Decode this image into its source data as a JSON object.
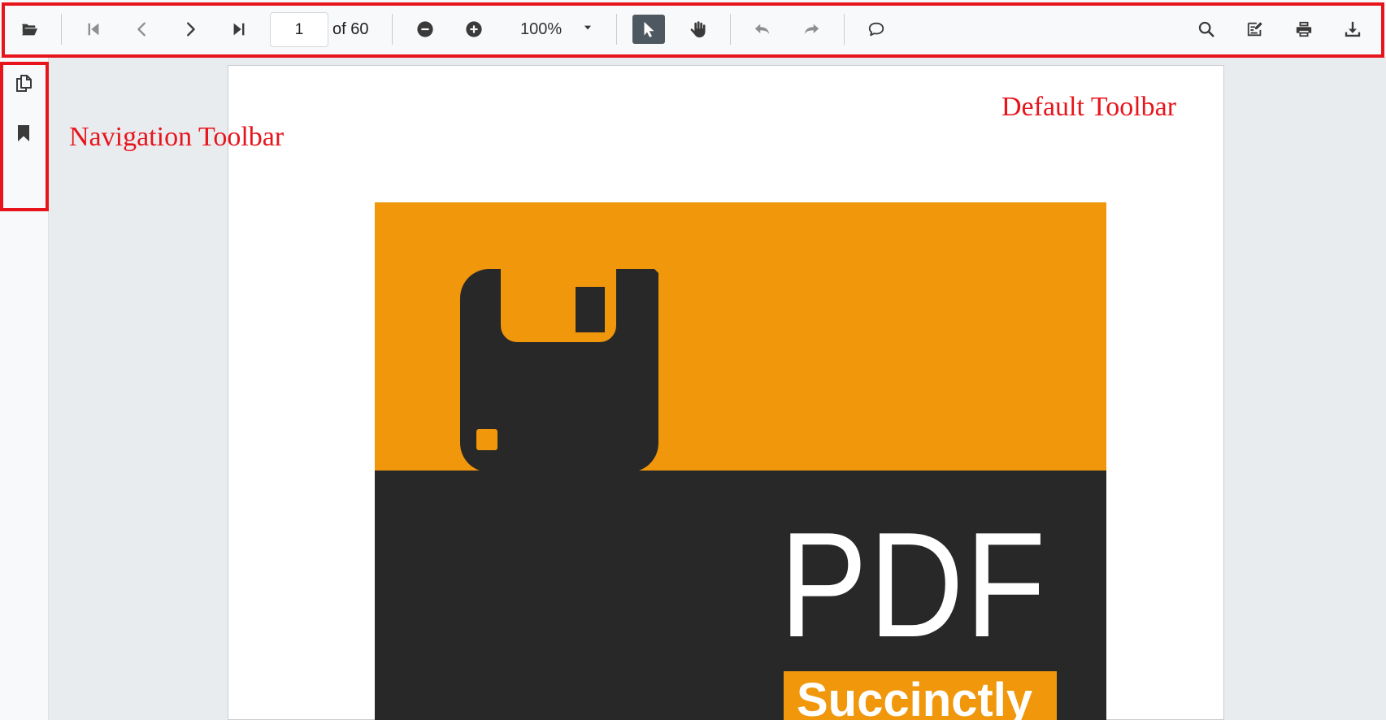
{
  "toolbar": {
    "page_number": "1",
    "page_total": "of 60",
    "zoom": "100%",
    "buttons": {
      "open": "folder-open-icon",
      "first_page": "first-page-icon",
      "previous_page": "chevron-left-icon",
      "next_page": "chevron-right-icon",
      "last_page": "last-page-icon",
      "zoom_out": "zoom-out-icon",
      "zoom_in": "zoom-in-icon",
      "text_selection": "cursor-arrow-icon",
      "pan": "hand-icon",
      "undo": "undo-icon",
      "redo": "redo-icon",
      "comment": "comment-icon",
      "search": "search-icon",
      "annotate": "annotation-edit-icon",
      "print": "print-icon",
      "download": "download-icon"
    }
  },
  "navigation": {
    "items": [
      "page-thumbnails-icon",
      "bookmark-icon"
    ]
  },
  "document": {
    "cover_title": "PDF",
    "cover_badge": "Succinctly"
  },
  "annotations": {
    "default_toolbar": "Default Toolbar",
    "navigation_toolbar": "Navigation Toolbar"
  },
  "colors": {
    "highlight": "#e8141c",
    "cover_orange": "#f0970c",
    "cover_dark": "#282828"
  }
}
